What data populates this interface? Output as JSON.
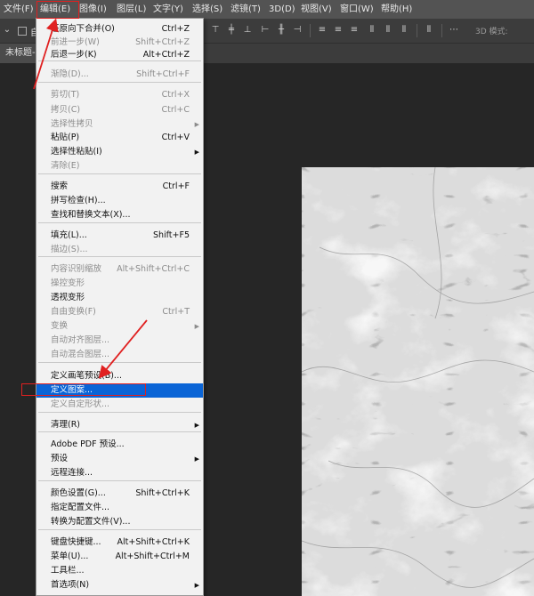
{
  "menubar": {
    "items": [
      "文件(F)",
      "编辑(E)",
      "图像(I)",
      "图层(L)",
      "文字(Y)",
      "选择(S)",
      "滤镜(T)",
      "3D(D)",
      "视图(V)",
      "窗口(W)",
      "帮助(H)"
    ]
  },
  "options_bar": {
    "partial_label": "自",
    "mode_label": "3D 模式:"
  },
  "document_tab": {
    "title": "未标题-"
  },
  "edit_menu": {
    "items": [
      {
        "label": "还原向下合并(O)",
        "shortcut": "Ctrl+Z",
        "enabled": true
      },
      {
        "label": "前进一步(W)",
        "shortcut": "Shift+Ctrl+Z",
        "enabled": false
      },
      {
        "label": "后退一步(K)",
        "shortcut": "Alt+Ctrl+Z",
        "enabled": true
      },
      {
        "label": "渐隐(D)...",
        "shortcut": "Shift+Ctrl+F",
        "enabled": false
      },
      {
        "label": "剪切(T)",
        "shortcut": "Ctrl+X",
        "enabled": false
      },
      {
        "label": "拷贝(C)",
        "shortcut": "Ctrl+C",
        "enabled": false
      },
      {
        "label": "选择性拷贝",
        "shortcut": "",
        "enabled": false,
        "submenu": true
      },
      {
        "label": "粘贴(P)",
        "shortcut": "Ctrl+V",
        "enabled": true
      },
      {
        "label": "选择性粘贴(I)",
        "shortcut": "",
        "enabled": true,
        "submenu": true
      },
      {
        "label": "清除(E)",
        "shortcut": "",
        "enabled": false
      },
      {
        "label": "搜索",
        "shortcut": "Ctrl+F",
        "enabled": true
      },
      {
        "label": "拼写检查(H)...",
        "shortcut": "",
        "enabled": true
      },
      {
        "label": "查找和替换文本(X)...",
        "shortcut": "",
        "enabled": true
      },
      {
        "label": "填充(L)...",
        "shortcut": "Shift+F5",
        "enabled": true
      },
      {
        "label": "描边(S)...",
        "shortcut": "",
        "enabled": false
      },
      {
        "label": "内容识别缩放",
        "shortcut": "Alt+Shift+Ctrl+C",
        "enabled": false
      },
      {
        "label": "操控变形",
        "shortcut": "",
        "enabled": false
      },
      {
        "label": "透视变形",
        "shortcut": "",
        "enabled": true
      },
      {
        "label": "自由变换(F)",
        "shortcut": "Ctrl+T",
        "enabled": false
      },
      {
        "label": "变换",
        "shortcut": "",
        "enabled": false,
        "submenu": true
      },
      {
        "label": "自动对齐图层...",
        "shortcut": "",
        "enabled": false
      },
      {
        "label": "自动混合图层...",
        "shortcut": "",
        "enabled": false
      },
      {
        "label": "定义画笔预设(B)...",
        "shortcut": "",
        "enabled": true
      },
      {
        "label": "定义图案...",
        "shortcut": "",
        "enabled": true,
        "highlighted": true
      },
      {
        "label": "定义自定形状...",
        "shortcut": "",
        "enabled": false
      },
      {
        "label": "清理(R)",
        "shortcut": "",
        "enabled": true,
        "submenu": true
      },
      {
        "label": "Adobe PDF 预设...",
        "shortcut": "",
        "enabled": true
      },
      {
        "label": "预设",
        "shortcut": "",
        "enabled": true,
        "submenu": true
      },
      {
        "label": "远程连接...",
        "shortcut": "",
        "enabled": true
      },
      {
        "label": "颜色设置(G)...",
        "shortcut": "Shift+Ctrl+K",
        "enabled": true
      },
      {
        "label": "指定配置文件...",
        "shortcut": "",
        "enabled": true
      },
      {
        "label": "转换为配置文件(V)...",
        "shortcut": "",
        "enabled": true
      },
      {
        "label": "键盘快捷键...",
        "shortcut": "Alt+Shift+Ctrl+K",
        "enabled": true
      },
      {
        "label": "菜单(U)...",
        "shortcut": "Alt+Shift+Ctrl+M",
        "enabled": true
      },
      {
        "label": "工具栏...",
        "shortcut": "",
        "enabled": true
      },
      {
        "label": "首选项(N)",
        "shortcut": "",
        "enabled": true,
        "submenu": true
      }
    ]
  },
  "colors": {
    "highlight": "#0a64d6",
    "annotation_red": "#e02020",
    "menubar_bg": "#535353",
    "workspace_bg": "#262626"
  }
}
